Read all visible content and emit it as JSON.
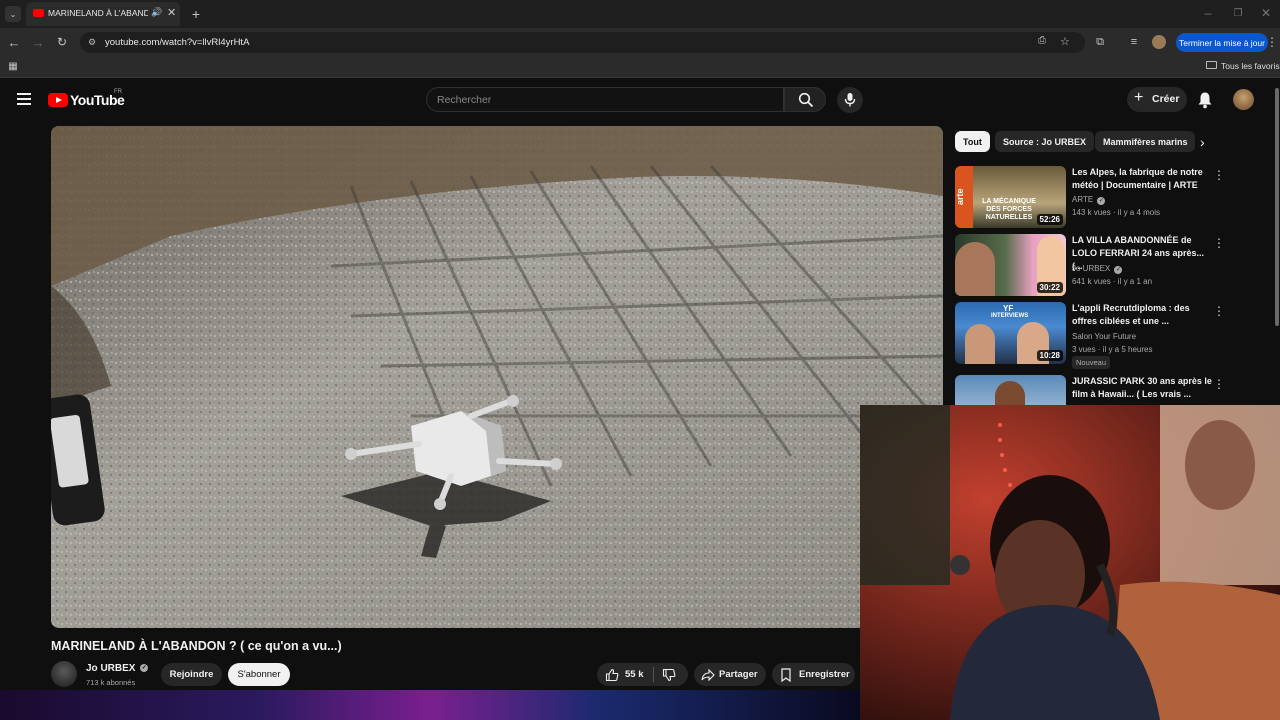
{
  "browser": {
    "tab_title": "MARINELAND À L'ABANDON ? ( ce qu'on a vu...)",
    "url": "youtube.com/watch?v=llvRl4yrHtA",
    "update_button": "Terminer la mise à jour",
    "bookmarks_label": "Tous les favoris"
  },
  "header": {
    "logo_text": "YouTube",
    "region": "FR",
    "search_placeholder": "Rechercher",
    "create_label": "Créer"
  },
  "video": {
    "title": "MARINELAND À L'ABANDON ? ( ce qu'on a vu...)",
    "channel": "Jo URBEX",
    "subscribers": "713 k abonnés",
    "join_label": "Rejoindre",
    "subscribe_label": "S'abonner",
    "likes": "55 k",
    "share_label": "Partager",
    "save_label": "Enregistrer"
  },
  "chips": [
    "Tout",
    "Source : Jo URBEX",
    "Mammifères marins"
  ],
  "recommendations": [
    {
      "title": "Les Alpes, la fabrique de notre météo | Documentaire | ARTE",
      "channel": "ARTE",
      "meta": "143 k vues · il y a 4 mois",
      "duration": "52:26",
      "thumb_text": "LA MÉCANIQUE DES FORCES NATURELLES",
      "thumb_brand": "arte",
      "badge": ""
    },
    {
      "title": "LA VILLA ABANDONNÉE de LOLO FERRARI 24 ans après...(...",
      "channel": "Jo URBEX",
      "meta": "641 k vues · il y a 1 an",
      "duration": "30:22",
      "thumb_text": "",
      "thumb_brand": "",
      "badge": ""
    },
    {
      "title": "L'appli Recrutdiploma : des offres ciblées et une ...",
      "channel": "Salon Your Future",
      "meta": "3 vues · il y a 5 heures",
      "duration": "10:28",
      "thumb_text": "INTERVIEWS",
      "thumb_brand": "YF",
      "badge": "Nouveau"
    },
    {
      "title": "JURASSIC PARK 30 ans après le film à Hawaii... ( Les vrais ...",
      "channel": "",
      "meta": "",
      "duration": "",
      "thumb_text": "",
      "thumb_brand": "",
      "badge": ""
    }
  ]
}
